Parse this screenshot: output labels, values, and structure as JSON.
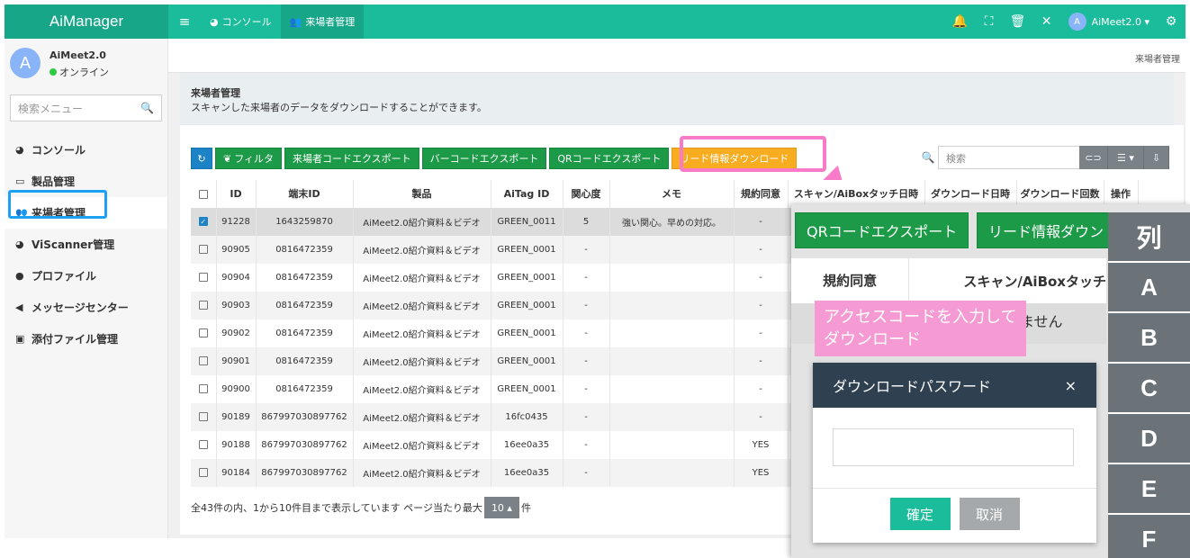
{
  "app": {
    "brand": "AiManager"
  },
  "topnav": [
    {
      "icon": "dashboard-icon",
      "label": "コンソール"
    },
    {
      "icon": "users-icon",
      "label": "来場者管理"
    }
  ],
  "topbar": {
    "user_label": "AiMeet2.0 ▾",
    "avatar_letter": "A"
  },
  "sidebar": {
    "user_name": "AiMeet2.0",
    "user_status": "オンライン",
    "avatar_letter": "A",
    "search_placeholder": "検索メニュー",
    "items": [
      {
        "label": "コンソール"
      },
      {
        "label": "製品管理"
      },
      {
        "label": "来場者管理"
      },
      {
        "label": "ViScanner管理"
      },
      {
        "label": "プロファイル"
      },
      {
        "label": "メッセージセンター"
      },
      {
        "label": "添付ファイル管理"
      }
    ]
  },
  "breadcrumb": "来場者管理",
  "page": {
    "title": "来場者管理",
    "desc": "スキャンした来場者のデータをダウンロードすることができます。"
  },
  "toolbar": {
    "filter": "フィルタ",
    "export_visitor": "来場者コードエクスポート",
    "export_barcode": "バーコードエクスポート",
    "export_qr": "QRコードエクスポート",
    "lead_download": "リード情報ダウンロード",
    "search_placeholder": "検索"
  },
  "table": {
    "headers": [
      "ID",
      "端末ID",
      "製品",
      "AiTag ID",
      "関心度",
      "メモ",
      "規約同意",
      "スキャン/AiBoxタッチ日時",
      "ダウンロード日時",
      "ダウンロード回数",
      "操作"
    ],
    "rows": [
      {
        "id": "91228",
        "device": "1643259870",
        "product": "AiMeet2.0紹介資料＆ビデオ",
        "tag": "GREEN_0011",
        "interest": "5",
        "memo": "強い関心。早めの対応。",
        "consent": "-"
      },
      {
        "id": "90905",
        "device": "0816472359",
        "product": "AiMeet2.0紹介資料＆ビデオ",
        "tag": "GREEN_0001",
        "interest": "-",
        "memo": "",
        "consent": "-"
      },
      {
        "id": "90904",
        "device": "0816472359",
        "product": "AiMeet2.0紹介資料＆ビデオ",
        "tag": "GREEN_0001",
        "interest": "-",
        "memo": "",
        "consent": "-"
      },
      {
        "id": "90903",
        "device": "0816472359",
        "product": "AiMeet2.0紹介資料＆ビデオ",
        "tag": "GREEN_0001",
        "interest": "-",
        "memo": "",
        "consent": "-"
      },
      {
        "id": "90902",
        "device": "0816472359",
        "product": "AiMeet2.0紹介資料＆ビデオ",
        "tag": "GREEN_0001",
        "interest": "-",
        "memo": "",
        "consent": "-"
      },
      {
        "id": "90901",
        "device": "0816472359",
        "product": "AiMeet2.0紹介資料＆ビデオ",
        "tag": "GREEN_0001",
        "interest": "-",
        "memo": "",
        "consent": "-"
      },
      {
        "id": "90900",
        "device": "0816472359",
        "product": "AiMeet2.0紹介資料＆ビデオ",
        "tag": "GREEN_0001",
        "interest": "-",
        "memo": "",
        "consent": "-"
      },
      {
        "id": "90189",
        "device": "867997030897762",
        "product": "AiMeet2.0紹介資料＆ビデオ",
        "tag": "16fc0435",
        "interest": "-",
        "memo": "",
        "consent": "-"
      },
      {
        "id": "90188",
        "device": "867997030897762",
        "product": "AiMeet2.0紹介資料＆ビデオ",
        "tag": "16ee0a35",
        "interest": "-",
        "memo": "",
        "consent": "YES"
      },
      {
        "id": "90184",
        "device": "867997030897762",
        "product": "AiMeet2.0紹介資料＆ビデオ",
        "tag": "16ee0a35",
        "interest": "-",
        "memo": "",
        "consent": "YES"
      }
    ]
  },
  "pagination": {
    "summary": "全43件の内、1から10件目まで表示しています ページ当たり最大",
    "page_size": "10 ▴",
    "suffix": "件"
  },
  "zoom": {
    "btn_qr": "QRコードエクスポート",
    "btn_lead": "リード情報ダウン",
    "col_consent": "規約同意",
    "col_scan": "スキャン/AiBoxタッチ",
    "partial_text": "ません"
  },
  "callout": "アクセスコードを入力してダウンロード",
  "modal": {
    "title": "ダウンロードパスワード",
    "close": "×",
    "ok": "確定",
    "cancel": "取消"
  },
  "columns": {
    "header": "列",
    "letters": [
      "A",
      "B",
      "C",
      "D",
      "E",
      "F"
    ]
  }
}
